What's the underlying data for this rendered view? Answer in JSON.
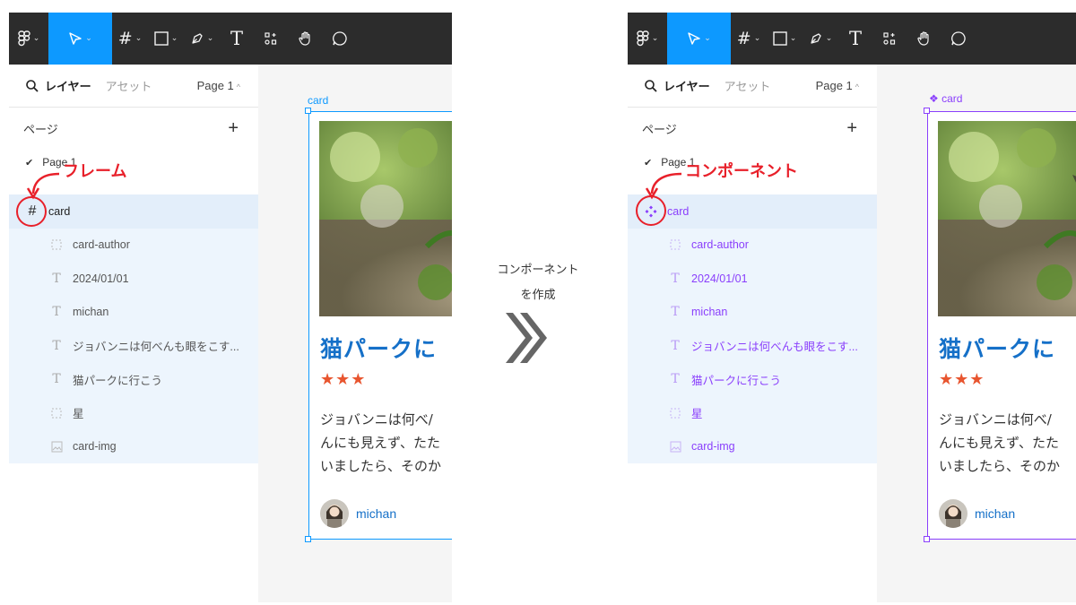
{
  "toolbar": {
    "icons": [
      "figma-logo",
      "move-tool",
      "frame-tool",
      "shape-tool",
      "pen-tool",
      "text-tool",
      "resources-tool",
      "hand-tool",
      "comment-tool"
    ],
    "active_color": "#0d99ff",
    "background": "#2c2c2c"
  },
  "sidebar": {
    "tab_layers": "レイヤー",
    "tab_assets": "アセット",
    "page_selector": "Page 1",
    "pages_title": "ページ",
    "page_item": "Page 1"
  },
  "layers": {
    "root": "card",
    "children": [
      {
        "label": "card-author",
        "icon": "auto-layout-icon"
      },
      {
        "label": "2024/01/01",
        "icon": "text-icon"
      },
      {
        "label": "michan",
        "icon": "text-icon"
      },
      {
        "label": "ジョバンニは何べんも眼をこす...",
        "icon": "text-icon"
      },
      {
        "label": "猫パークに行こう",
        "icon": "text-icon"
      },
      {
        "label": "星",
        "icon": "auto-layout-icon"
      },
      {
        "label": "card-img",
        "icon": "image-icon"
      }
    ]
  },
  "annotations": {
    "left": "フレーム",
    "right": "コンポーネント",
    "color": "#e8202a"
  },
  "card": {
    "label": "card",
    "title": "猫パークに",
    "stars": "★★★",
    "body_lines": [
      "ジョバンニは何べ/",
      "んにも見えず、たた",
      "いましたら、そのか"
    ],
    "author": "michan"
  },
  "middle": {
    "line1": "コンポーネント",
    "line2": "を作成"
  },
  "colors": {
    "frame_selection": "#0d99ff",
    "component_selection": "#8a3ffc",
    "title_blue": "#1570c8",
    "stars": "#e8552f"
  }
}
